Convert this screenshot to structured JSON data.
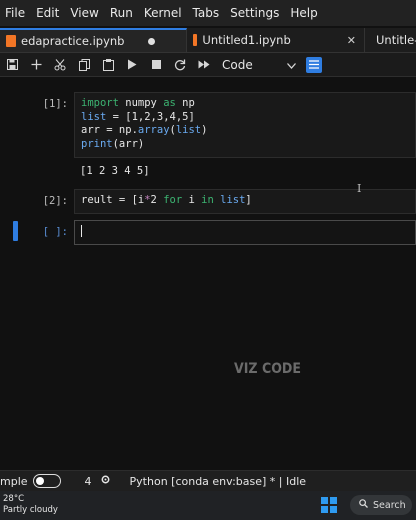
{
  "menu": [
    "File",
    "Edit",
    "View",
    "Run",
    "Kernel",
    "Tabs",
    "Settings",
    "Help"
  ],
  "tabs": [
    {
      "label": "edapractice.ipynb",
      "state": "unsaved"
    },
    {
      "label": "Untitled1.ipynb",
      "state": "close"
    },
    {
      "label": "Untitle-"
    }
  ],
  "toolbar": {
    "icons": [
      "save-icon",
      "add-icon",
      "cut-icon",
      "copy-icon",
      "paste-icon",
      "run-icon",
      "stop-icon",
      "restart-icon",
      "fast-forward-icon"
    ],
    "cell_type": "Code"
  },
  "cells": [
    {
      "prompt": "[1]:",
      "code_lines": [
        "import numpy as np",
        "list = [1,2,3,4,5]",
        "arr = np.array(list)",
        "print(arr)"
      ],
      "output": "[1 2 3 4 5]"
    },
    {
      "prompt": "[2]:",
      "code_lines": [
        "reult = [i*2 for i in list]"
      ]
    },
    {
      "prompt": "[ ]:",
      "code_lines": [
        ""
      ]
    }
  ],
  "watermark": "VIZ CODE",
  "status": {
    "mode_label": "mple",
    "count": "4",
    "kernel": "Python [conda env:base] * | Idle"
  },
  "taskbar": {
    "temperature": "28°C",
    "weather": "Partly cloudy",
    "search": "Search"
  },
  "colors": {
    "accent": "#2f7de1",
    "keyword": "#3cb371",
    "function": "#6aaaf0"
  }
}
